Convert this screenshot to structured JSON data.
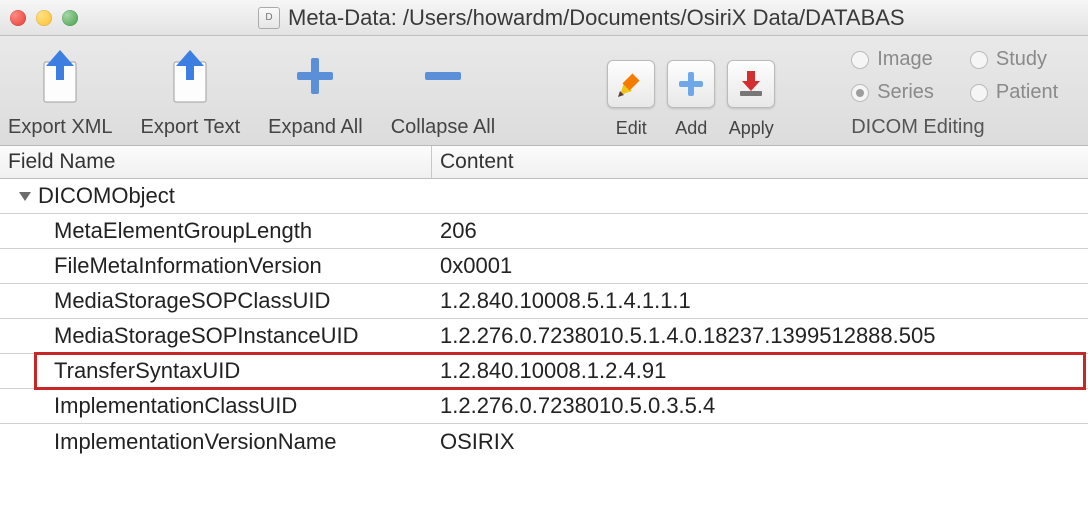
{
  "window": {
    "title": "Meta-Data: /Users/howardm/Documents/OsiriX Data/DATABAS"
  },
  "toolbar": {
    "export_xml": "Export XML",
    "export_text": "Export Text",
    "expand_all": "Expand All",
    "collapse_all": "Collapse All",
    "edit": "Edit",
    "add": "Add",
    "apply": "Apply",
    "section_label": "DICOM Editing",
    "radios": {
      "image": "Image",
      "study": "Study",
      "series": "Series",
      "patient": "Patient",
      "selected": "series"
    }
  },
  "table": {
    "headers": {
      "field": "Field Name",
      "content": "Content"
    },
    "root": "DICOMObject",
    "rows": [
      {
        "field": "MetaElementGroupLength",
        "content": "206"
      },
      {
        "field": "FileMetaInformationVersion",
        "content": "0x0001"
      },
      {
        "field": "MediaStorageSOPClassUID",
        "content": "1.2.840.10008.5.1.4.1.1.1"
      },
      {
        "field": "MediaStorageSOPInstanceUID",
        "content": "1.2.276.0.7238010.5.1.4.0.18237.1399512888.505"
      },
      {
        "field": "TransferSyntaxUID",
        "content": "1.2.840.10008.1.2.4.91",
        "highlight": true
      },
      {
        "field": "ImplementationClassUID",
        "content": "1.2.276.0.7238010.5.0.3.5.4"
      },
      {
        "field": "ImplementationVersionName",
        "content": "OSIRIX"
      }
    ]
  }
}
